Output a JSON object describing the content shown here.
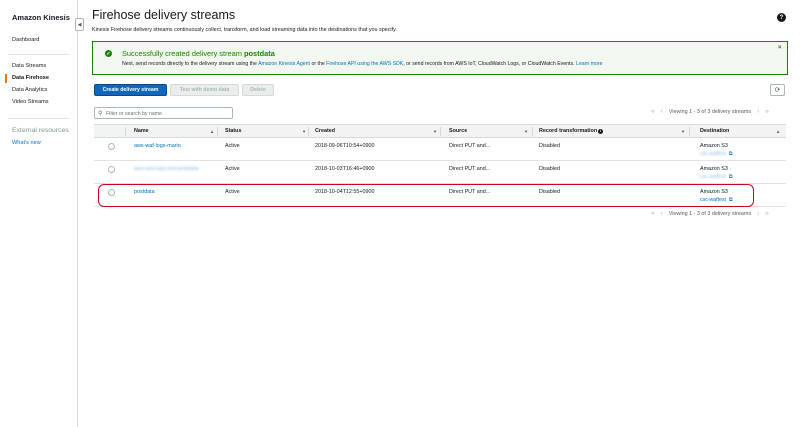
{
  "sidebar": {
    "title": "Amazon Kinesis",
    "collapse_glyph": "◀",
    "items": [
      {
        "label": "Dashboard"
      },
      {
        "label": "Data Streams"
      },
      {
        "label": "Data Firehose"
      },
      {
        "label": "Data Analytics"
      },
      {
        "label": "Video Streams"
      }
    ],
    "section_label": "External resources",
    "whats_new": "What's new"
  },
  "header": {
    "title": "Firehose delivery streams",
    "help_glyph": "?",
    "description": "Kinesis Firehose delivery streams continuously collect, transform, and load streaming data into the destinations that you specify."
  },
  "flash": {
    "title_prefix": "Successfully created delivery stream",
    "stream_name": "postdata",
    "body_1": "Next, send records directly to the delivery stream using the",
    "link_1": "Amazon Kinesis Agent",
    "body_2": "or the",
    "link_2": "Firehose API using the AWS SDK",
    "body_3": ", or send records from AWS IoT, CloudWatch Logs, or CloudWatch Events.",
    "link_3": "Learn more",
    "close_glyph": "×",
    "icon_glyph": "✓",
    "color": "#1d8102"
  },
  "toolbar": {
    "create_label": "Create delivery stream",
    "test_label": "Test with demo data",
    "delete_label": "Delete",
    "refresh_glyph": "⟳",
    "primary_color": "#1166bb"
  },
  "filter": {
    "placeholder": "Filter or search by name",
    "icon_glyph": "⚲"
  },
  "pagination": {
    "text": "Viewing 1 - 3 of 3 delivery streams",
    "first": "«",
    "prev": "‹",
    "next": "›",
    "last": "»"
  },
  "table": {
    "columns": {
      "name": "Name",
      "status": "Status",
      "created": "Created",
      "source": "Source",
      "transformation": "Record transformation",
      "destination": "Destination"
    },
    "sort_asc": "▲",
    "sort_desc": "▼",
    "info_glyph": "i",
    "ext_glyph": "⧉",
    "rows": [
      {
        "name": "aws-waf-logs-mario",
        "status": "Active",
        "created": "2018-09-06T10:54+0900",
        "source": "Direct PUT and...",
        "transformation": "Disabled",
        "destination": "Amazon S3",
        "bucket": "csc-waffest"
      },
      {
        "name": "aws-waf-logs-test-postdata",
        "status": "Active",
        "created": "2018-10-03T16:46+0900",
        "source": "Direct PUT and...",
        "transformation": "Disabled",
        "destination": "Amazon S3",
        "bucket": "csc-waffest"
      },
      {
        "name": "postdata",
        "status": "Active",
        "created": "2018-10-04T12:55+0900",
        "source": "Direct PUT and...",
        "transformation": "Disabled",
        "destination": "Amazon S3",
        "bucket": "csc-waftest"
      }
    ]
  },
  "highlight_color": "#d0021b"
}
